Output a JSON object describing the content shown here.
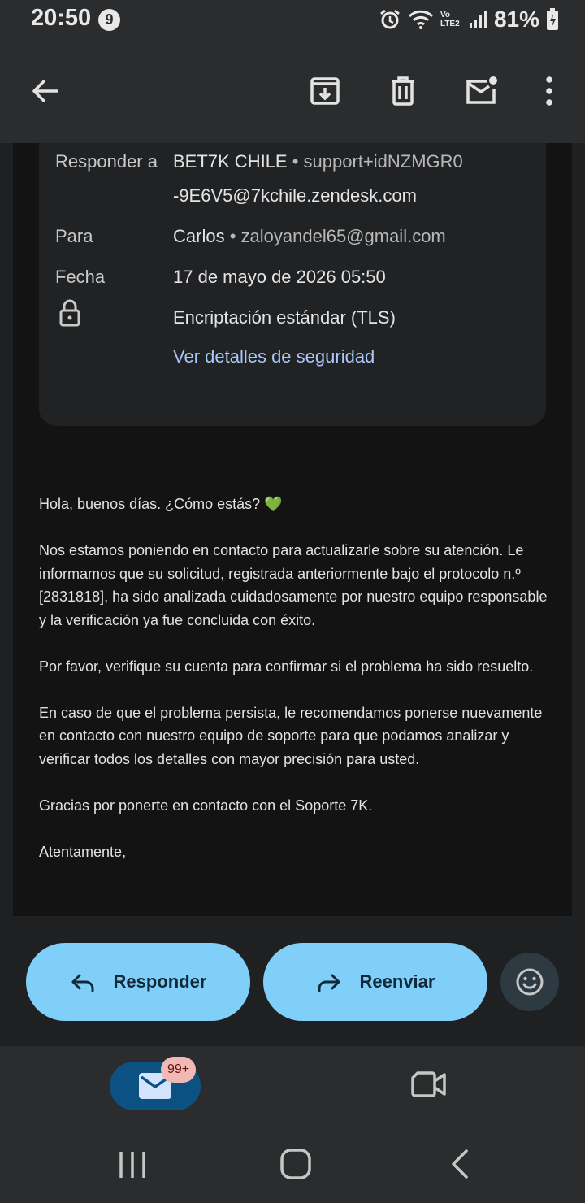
{
  "status_bar": {
    "time": "20:50",
    "notification_count": "9",
    "network": "Vo LTE2",
    "battery": "81%"
  },
  "app_bar": {
    "back_icon": "arrow-back-icon",
    "archive_icon": "archive-icon",
    "delete_icon": "trash-icon",
    "mark_unread_icon": "mail-unread-icon",
    "more_icon": "more-vert-icon"
  },
  "details": {
    "reply_to_label": "Responder a",
    "reply_to_name": "BET7K CHILE",
    "reply_to_email_1": "• support+idNZMGR0",
    "reply_to_email_2": "-9E6V5@7kchile.zendesk.com",
    "to_label": "Para",
    "to_name": "Carlos",
    "to_email": "• zaloyandel65@gmail.com",
    "date_label": "Fecha",
    "date_value": "17 de mayo de 2026 05:50",
    "encryption_value": "Encriptación estándar (TLS)",
    "security_link": "Ver detalles de seguridad"
  },
  "body": {
    "greeting": "Hola, buenos días. ¿Cómo estás? 💚",
    "p1": "Nos estamos poniendo en contacto para actualizarle sobre su atención. Le informamos que su solicitud, registrada anteriormente bajo el protocolo n.º [2831818], ha sido analizada cuidadosamente por nuestro equipo responsable y la verificación ya fue concluida con éxito.",
    "p2": "Por favor, verifique su cuenta para confirmar si el problema ha sido resuelto.",
    "p3": "En caso de que el problema persista, le recomendamos ponerse nuevamente en contacto con nuestro equipo de soporte para que podamos analizar y verificar todos los detalles con mayor precisión para usted.",
    "p4": "Gracias por ponerte en contacto con el Soporte 7K.",
    "closing": "Atentamente,"
  },
  "actions": {
    "reply_label": "Responder",
    "forward_label": "Reenviar"
  },
  "bottom_nav": {
    "mail_badge": "99+"
  },
  "colors": {
    "accent_button": "#7fcff9",
    "link": "#a8c7fa",
    "mail_pill": "#0b5283"
  }
}
